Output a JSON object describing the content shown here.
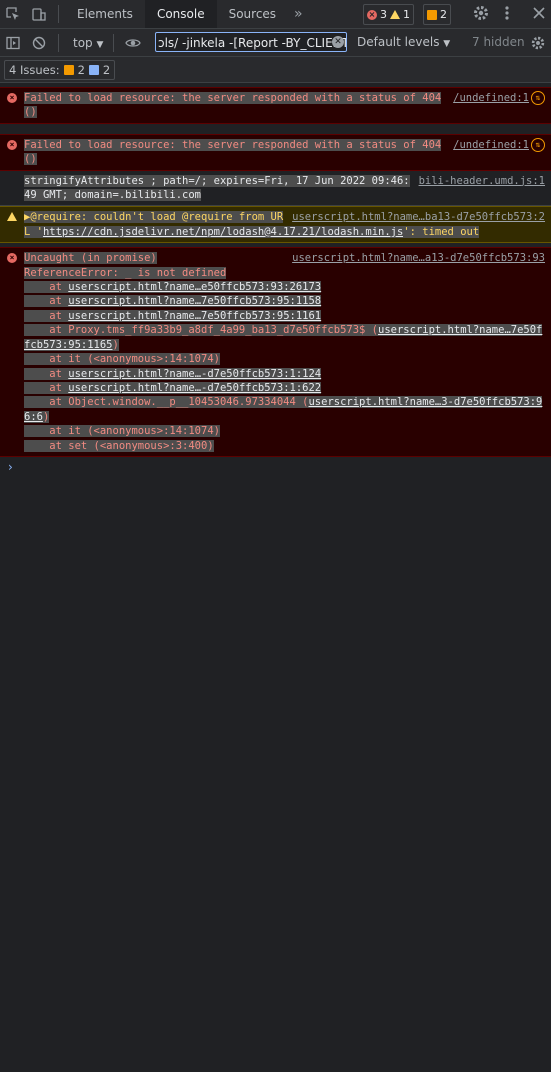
{
  "tabs": [
    "Elements",
    "Console",
    "Sources"
  ],
  "active_tab": "Console",
  "counters": {
    "errors": "3",
    "warnings": "1",
    "issues": "2"
  },
  "toolbar": {
    "context": "top",
    "filter_value": "ɔls/ -jinkela -[Report -BY_CLIENT",
    "levels": "Default levels",
    "hidden": "7 hidden"
  },
  "issues_bar": {
    "label": "4 Issues:",
    "warn_count": "2",
    "info_count": "2"
  },
  "messages": [
    {
      "type": "error",
      "text": "Failed to load resource: the server responded with a status of 404 ()",
      "source": "/undefined:1"
    },
    {
      "type": "error",
      "text": "Failed to load resource: the server responded with a status of 404 ()",
      "source": "/undefined:1"
    },
    {
      "type": "log",
      "text": "stringifyAttributes ; path=/; expires=Fri, 17 Jun 2022 09:46:49 GMT; domain=.bilibili.com",
      "source": "bili-header.umd.js:1"
    },
    {
      "type": "warning",
      "prefix": "▶@require: couldn't load @require from URL '",
      "url": "https://cdn.jsdelivr.net/npm/lodash@4.17.21/lodash.min.js",
      "suffix": "': timed out",
      "source": "userscript.html?name…ba13-d7e50ffcb573:2"
    },
    {
      "type": "error",
      "text": "Uncaught (in promise)",
      "source": "userscript.html?name…a13-d7e50ffcb573:93",
      "detail": "ReferenceError: _ is not defined",
      "frames": [
        {
          "pre": "    at ",
          "link": "userscript.html?name…e50ffcb573:93:26173",
          "post": ""
        },
        {
          "pre": "    at ",
          "link": "userscript.html?name…7e50ffcb573:95:1158",
          "post": ""
        },
        {
          "pre": "    at ",
          "link": "userscript.html?name…7e50ffcb573:95:1161",
          "post": ""
        },
        {
          "pre": "    at Proxy.tms_ff9a33b9_a8df_4a99_ba13_d7e50ffcb573$ (",
          "link": "userscript.html?name…7e50ffcb573:95:1165",
          "post": ")"
        },
        {
          "pre": "    at it (<anonymous>:14:1074)",
          "link": "",
          "post": ""
        },
        {
          "pre": "    at ",
          "link": "userscript.html?name…-d7e50ffcb573:1:124",
          "post": ""
        },
        {
          "pre": "    at ",
          "link": "userscript.html?name…-d7e50ffcb573:1:622",
          "post": ""
        },
        {
          "pre": "    at Object.window.__p__10453046.97334044 (",
          "link": "userscript.html?name…3-d7e50ffcb573:96:6",
          "post": ")"
        },
        {
          "pre": "    at it (<anonymous>:14:1074)",
          "link": "",
          "post": ""
        },
        {
          "pre": "    at set (<anonymous>:3:400)",
          "link": "",
          "post": ""
        }
      ]
    }
  ],
  "prompt": "›"
}
